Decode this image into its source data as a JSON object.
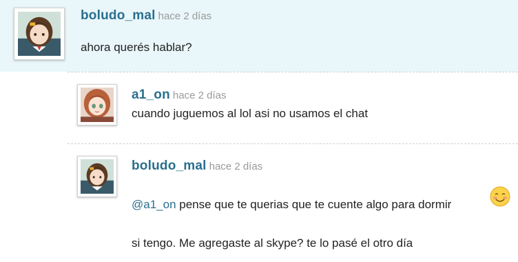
{
  "comments": [
    {
      "username": "boludo_mal",
      "time": "hace 2 días",
      "text": "ahora querés hablar?"
    },
    {
      "username": "a1_on",
      "time": "hace 2 días",
      "text": "cuando juguemos al lol asi no usamos el chat"
    },
    {
      "username": "boludo_mal",
      "time": "hace 2 días",
      "mention": "@a1_on",
      "text": " pense que te querias que te cuente algo para dormir",
      "emoji": "smiling-blush-emoji",
      "text2": "si tengo. Me agregaste al skype? te lo pasé el otro día"
    }
  ],
  "colors": {
    "username": "#2a6f8e",
    "time": "#9a9a9a",
    "highlight_bg": "#e9f6fa"
  }
}
